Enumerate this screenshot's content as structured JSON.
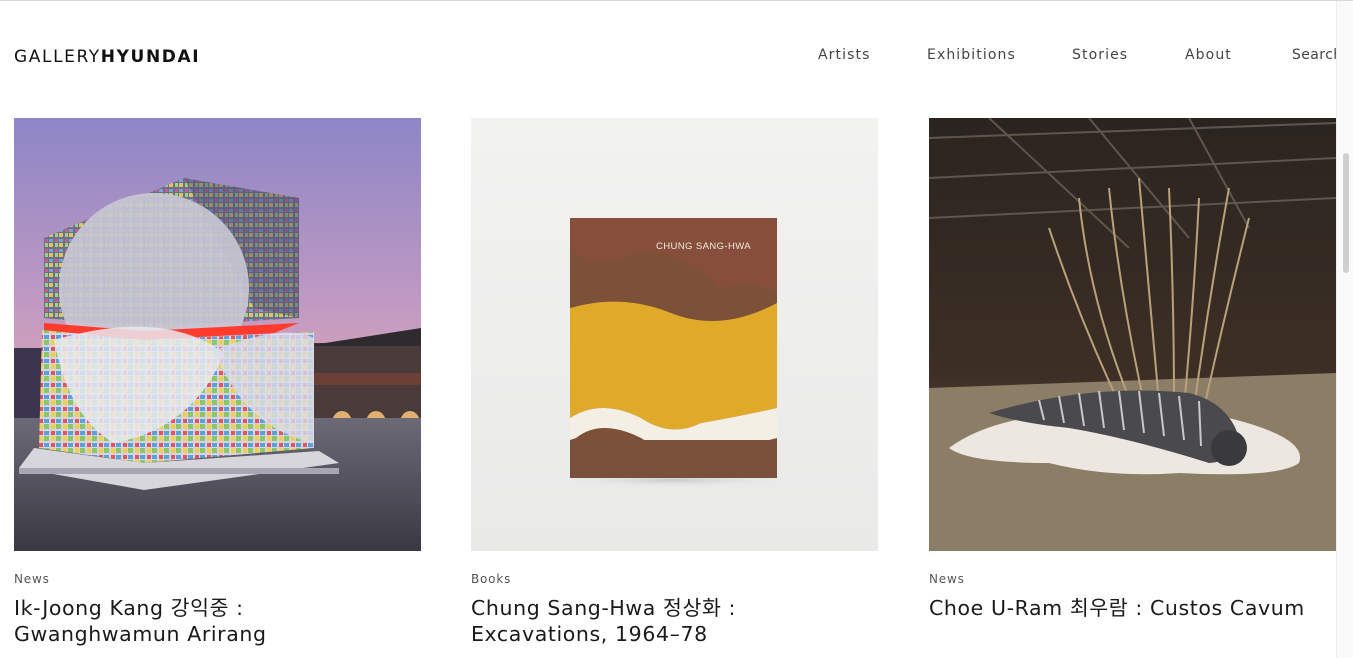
{
  "header": {
    "logo_light": "GALLERY",
    "logo_bold": "HYUNDAI",
    "nav": [
      "Artists",
      "Exhibitions",
      "Stories",
      "About",
      "Search"
    ]
  },
  "cards": [
    {
      "category": "News",
      "title_line1": "Ik-Joong Kang 강익중 :",
      "title_line2": "Gwanghwamun Arirang"
    },
    {
      "category": "Books",
      "title_line1": "Chung Sang-Hwa 정상화 :",
      "title_line2": "Excavations, 1964–78",
      "book_cover_text": "CHUNG SANG-HWA"
    },
    {
      "category": "News",
      "title_line1": "Choe U-Ram 최우람 : Custos Cavum",
      "title_line2": ""
    }
  ],
  "colors": {
    "text": "#1a1a1a",
    "nav": "#444444",
    "book_brown": "#7a4f3a",
    "book_yellow": "#e0a92a"
  }
}
